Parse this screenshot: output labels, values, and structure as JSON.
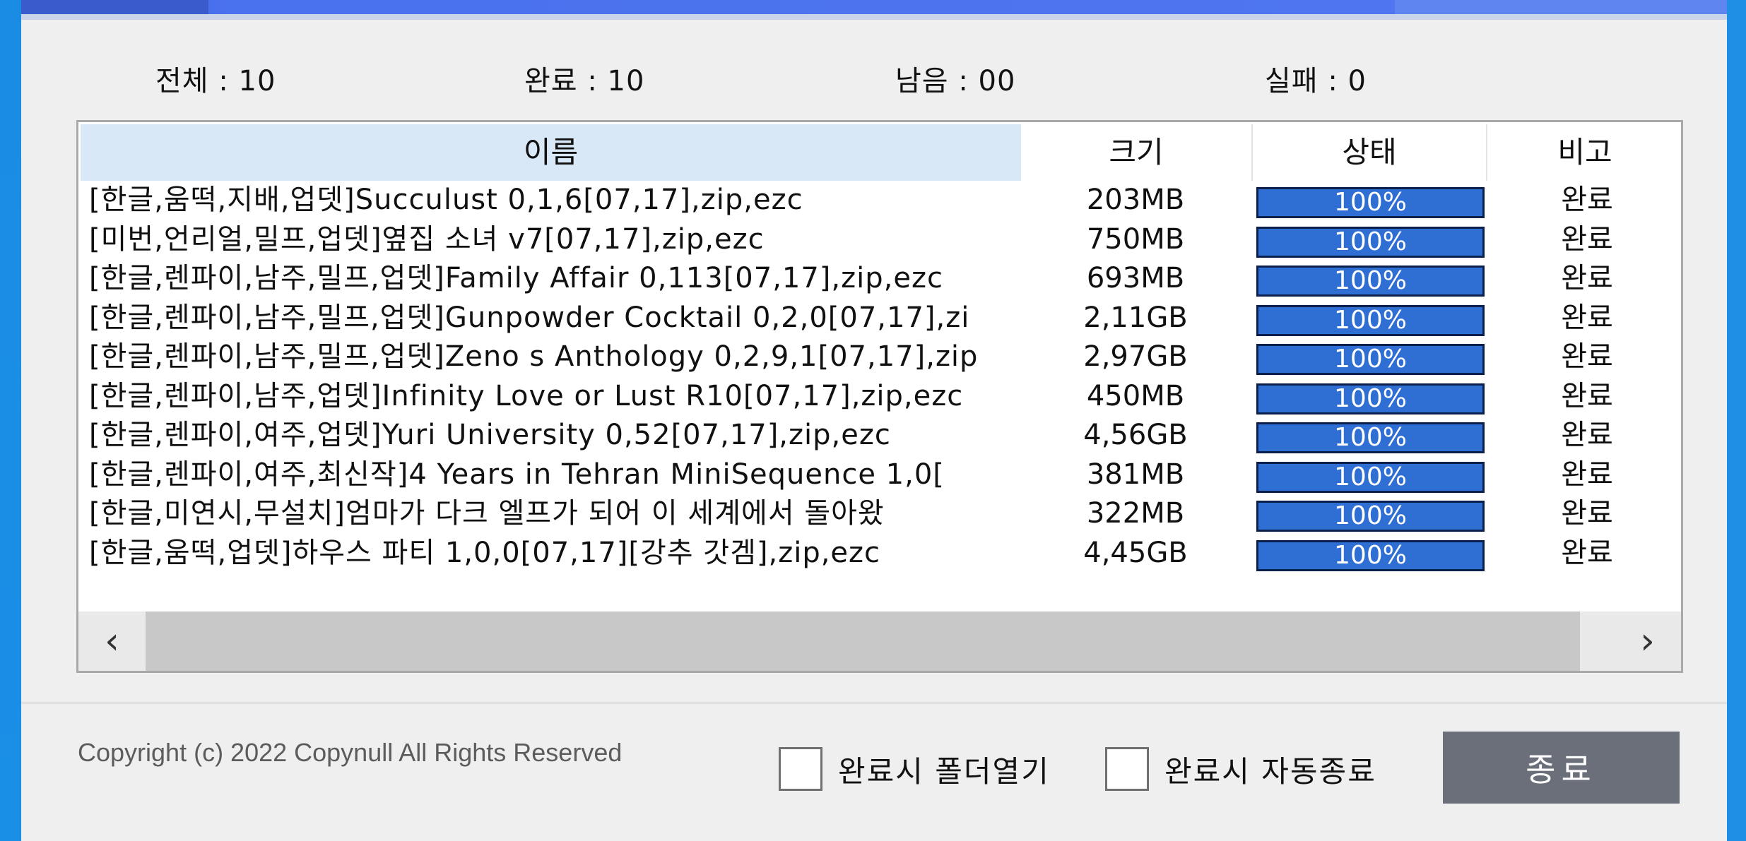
{
  "stats": {
    "total": "전체 : 10",
    "done": "완료 : 10",
    "remaining": "남음 : 00",
    "failed": "실패 : 0"
  },
  "table": {
    "headers": {
      "name": "이름",
      "size": "크기",
      "status": "상태",
      "note": "비고"
    },
    "rows": [
      {
        "name": "[한글,움떡,지배,업뎃]Succulust 0,1,6[07,17],zip,ezc",
        "size": "203MB",
        "progress": 100,
        "status": "100%",
        "note": "완료"
      },
      {
        "name": "[미번,언리얼,밀프,업뎃]옆집 소녀 v7[07,17],zip,ezc",
        "size": "750MB",
        "progress": 100,
        "status": "100%",
        "note": "완료"
      },
      {
        "name": "[한글,렌파이,남주,밀프,업뎃]Family Affair 0,113[07,17],zip,ezc",
        "size": "693MB",
        "progress": 100,
        "status": "100%",
        "note": "완료"
      },
      {
        "name": "[한글,렌파이,남주,밀프,업뎃]Gunpowder Cocktail 0,2,0[07,17],zi",
        "size": "2,11GB",
        "progress": 100,
        "status": "100%",
        "note": "완료"
      },
      {
        "name": "[한글,렌파이,남주,밀프,업뎃]Zeno s Anthology 0,2,9,1[07,17],zip",
        "size": "2,97GB",
        "progress": 100,
        "status": "100%",
        "note": "완료"
      },
      {
        "name": "[한글,렌파이,남주,업뎃]Infinity Love or Lust R10[07,17],zip,ezc",
        "size": "450MB",
        "progress": 100,
        "status": "100%",
        "note": "완료"
      },
      {
        "name": "[한글,렌파이,여주,업뎃]Yuri University 0,52[07,17],zip,ezc",
        "size": "4,56GB",
        "progress": 100,
        "status": "100%",
        "note": "완료"
      },
      {
        "name": "[한글,렌파이,여주,최신작]4 Years in Tehran MiniSequence 1,0[",
        "size": "381MB",
        "progress": 100,
        "status": "100%",
        "note": "완료"
      },
      {
        "name": "[한글,미연시,무설치]엄마가 다크 엘프가 되어 이 세계에서 돌아왔",
        "size": "322MB",
        "progress": 100,
        "status": "100%",
        "note": "완료"
      },
      {
        "name": "[한글,움떡,업뎃]하우스 파티 1,0,0[07,17][강추 갓겜],zip,ezc",
        "size": "4,45GB",
        "progress": 100,
        "status": "100%",
        "note": "완료"
      }
    ]
  },
  "scrollbar": {
    "left_icon": "chevron-left-icon",
    "right_icon": "chevron-right-icon",
    "left_glyph": "‹",
    "right_glyph": "›"
  },
  "footer": {
    "copyright": "Copyright (c) 2022 Copynull All Rights Reserved",
    "open_folder_label": "완료시 폴더열기",
    "auto_exit_label": "완료시 자동종료",
    "close_label": "종료"
  },
  "colors": {
    "progress_fill": "#2f6ed3",
    "close_button": "#6b6f7a",
    "header_highlight": "#d8e8f6",
    "top_bar": "#4a71ee"
  }
}
